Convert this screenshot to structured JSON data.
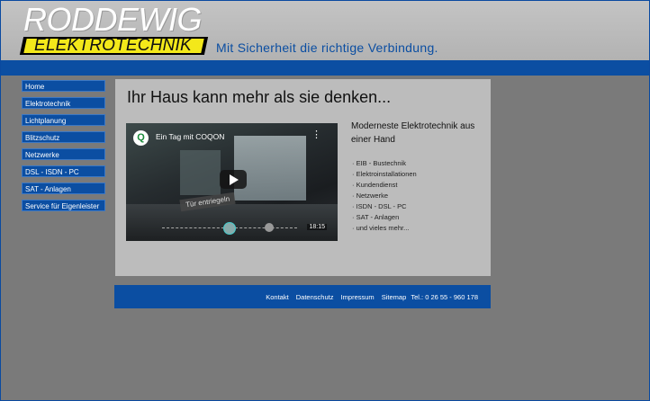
{
  "header": {
    "logo_top": "RODDEWIG",
    "logo_bottom": "ELEKTROTECHNIK",
    "slogan": "Mit Sicherheit die richtige Verbindung."
  },
  "nav": {
    "items": [
      "Home",
      "Elektrotechnik",
      "Lichtplanung",
      "Blitzschutz",
      "Netzwerke",
      "DSL - ISDN - PC",
      "SAT - Anlagen",
      "Service für Eigenleister"
    ]
  },
  "main": {
    "title": "Ihr Haus kann mehr als sie denken...",
    "video": {
      "logo": "Q",
      "title": "Ein Tag mit COQON",
      "tag": "Tür entriegeln",
      "time": "18:15"
    },
    "right_heading": "Moderneste Elektrotechnik aus einer Hand",
    "features": [
      "· EIB - Bustechnik",
      "· Elektroinstallationen",
      "· Kundendienst",
      "· Netzwerke",
      "· ISDN - DSL - PC",
      "· SAT - Anlagen",
      "· und vieles mehr..."
    ]
  },
  "footer": {
    "links": [
      "Kontakt",
      "Datenschutz",
      "Impressum",
      "Sitemap"
    ],
    "tel": "Tel.: 0 26 55 - 960 178"
  },
  "colors": {
    "brand_blue": "#0b4ea2",
    "logo_yellow": "#f3e81a",
    "background": "#7a7a7a"
  }
}
